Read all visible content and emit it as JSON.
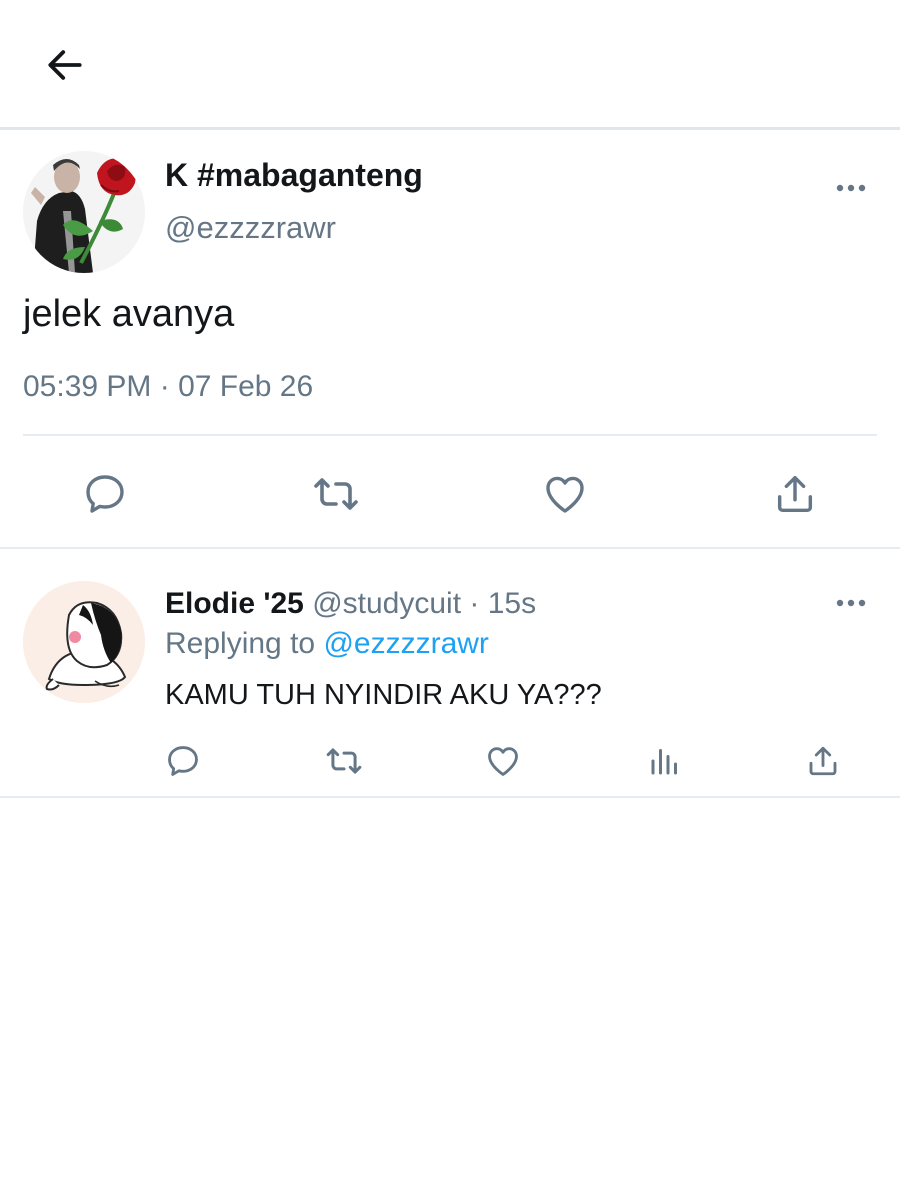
{
  "header": {
    "back_icon": "arrow-left-icon"
  },
  "tweet": {
    "author_name": "K #mabaganteng",
    "author_handle": "@ezzzzrawr",
    "text": "jelek avanya",
    "timestamp": "05:39 PM · 07 Feb 26",
    "more_icon": "more-horizontal-icon",
    "actions": [
      "reply-icon",
      "retweet-icon",
      "like-icon",
      "share-icon"
    ]
  },
  "reply": {
    "author_name": "Elodie '25",
    "author_handle": "@studycuit",
    "separator": "·",
    "age": "15s",
    "replying_to_label": "Replying to",
    "replying_to_handle": "@ezzzzrawr",
    "text": "KAMU TUH NYINDIR AKU YA???",
    "more_icon": "more-horizontal-icon",
    "actions": [
      "reply-icon",
      "retweet-icon",
      "like-icon",
      "analytics-icon",
      "share-icon"
    ]
  },
  "colors": {
    "text_primary": "#14171a",
    "text_secondary": "#657786",
    "link": "#1da1f2",
    "divider": "#e6ecf0",
    "icon": "#657786"
  }
}
